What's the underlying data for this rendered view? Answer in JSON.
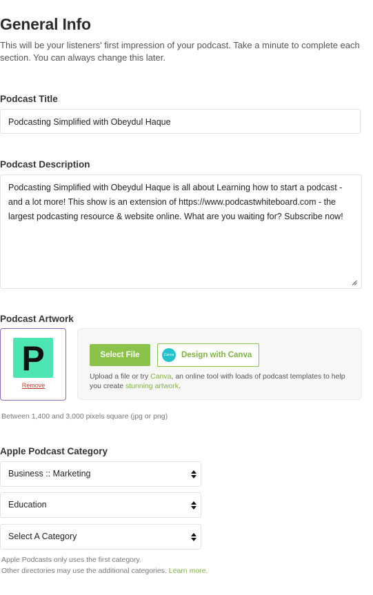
{
  "header": {
    "title": "General Info",
    "intro": "This will be your listeners' first impression of your podcast. Take a minute to complete each section. You can always change this later."
  },
  "title_field": {
    "label": "Podcast Title",
    "value": "Podcasting Simplified with Obeydul Haque"
  },
  "description_field": {
    "label": "Podcast Description",
    "value": "Podcasting Simplified with Obeydul Haque is all about  Learning how to start a podcast - and a lot more!  This show is an extension of https://www.podcastwhiteboard.com - the largest podcasting resource & website online. What are you waiting for? Subscribe now!"
  },
  "artwork": {
    "label": "Podcast Artwork",
    "thumbnail_letter": "P",
    "remove_label": "Remove",
    "select_file_label": "Select File",
    "canva_logo_text": "Canva",
    "design_canva_label": "Design with Canva",
    "upload_text_1": "Upload a file or try ",
    "upload_link_canva": "Canva",
    "upload_text_2": ", an online tool with loads of podcast templates to help you create ",
    "upload_link_artwork": "stunning artwork",
    "upload_text_3": ".",
    "hint": "Between 1,400 and 3,000 pixels square (jpg or png)"
  },
  "category": {
    "label": "Apple Podcast Category",
    "selects": [
      {
        "value": "Business :: Marketing"
      },
      {
        "value": "Education"
      },
      {
        "value": "Select A Category"
      }
    ],
    "note_1": "Apple Podcasts only uses the first category.",
    "note_2": "Other directories may use the additional categories. ",
    "learn_more": "Learn more."
  },
  "colors": {
    "accent_green": "#8bc34a",
    "artwork_border": "#8b68c6",
    "thumbnail_bg": "#4ee5b4",
    "remove_red": "#c0392b",
    "canva_teal": "#23c2cc"
  }
}
